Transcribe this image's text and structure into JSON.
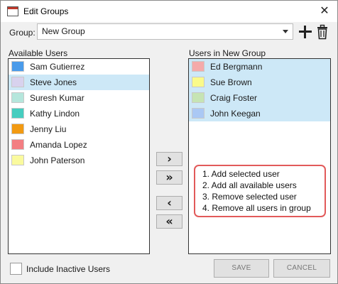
{
  "window": {
    "title": "Edit Groups",
    "app_icon_text": "LCRM"
  },
  "group": {
    "label": "Group:",
    "selected": "New Group"
  },
  "available": {
    "label": "Available Users",
    "users": [
      {
        "name": "Sam Gutierrez",
        "color": "#4a9bea",
        "selected": false
      },
      {
        "name": "Steve Jones",
        "color": "#d8d2ee",
        "selected": true
      },
      {
        "name": "Suresh Kumar",
        "color": "#b5e6dc",
        "selected": false
      },
      {
        "name": "Kathy Lindon",
        "color": "#46cdbf",
        "selected": false
      },
      {
        "name": "Jenny Liu",
        "color": "#f29a12",
        "selected": false
      },
      {
        "name": "Amanda Lopez",
        "color": "#f37e82",
        "selected": false
      },
      {
        "name": "John Paterson",
        "color": "#fafa9e",
        "selected": false
      }
    ]
  },
  "in_group": {
    "label": "Users in New Group",
    "users": [
      {
        "name": "Ed Bergmann",
        "color": "#f4aaaa",
        "selected": true
      },
      {
        "name": "Sue Brown",
        "color": "#fafa8a",
        "selected": true
      },
      {
        "name": "Craig Foster",
        "color": "#c6e4b4",
        "selected": true
      },
      {
        "name": "John Keegan",
        "color": "#aac8f4",
        "selected": true
      }
    ]
  },
  "buttons": {
    "add_selected": "›",
    "add_all": "»",
    "remove_selected": "‹",
    "remove_all": "«",
    "save": "SAVE",
    "cancel": "CANCEL"
  },
  "callout": [
    "1. Add selected user",
    "2. Add all available users",
    "3. Remove selected user",
    "4. Remove all users in group"
  ],
  "include_inactive_label": "Include Inactive Users"
}
